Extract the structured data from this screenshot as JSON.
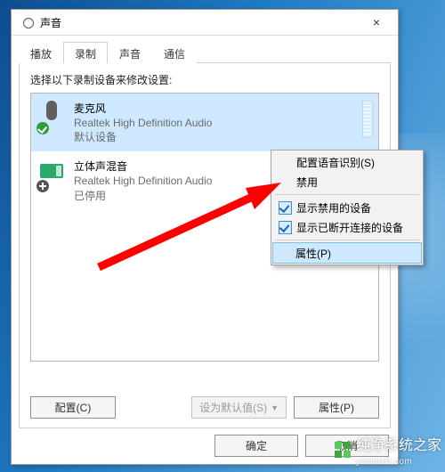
{
  "window": {
    "title": "声音",
    "close_label": "×"
  },
  "tabs": {
    "items": [
      {
        "label": "播放"
      },
      {
        "label": "录制"
      },
      {
        "label": "声音"
      },
      {
        "label": "通信"
      }
    ],
    "active_index": 1
  },
  "prompt": "选择以下录制设备来修改设置:",
  "devices": [
    {
      "name": "麦克风",
      "description": "Realtek High Definition Audio",
      "status": "默认设备",
      "selected": true,
      "badge": "ok",
      "icon": "mic"
    },
    {
      "name": "立体声混音",
      "description": "Realtek High Definition Audio",
      "status": "已停用",
      "selected": false,
      "badge": "off",
      "icon": "card"
    }
  ],
  "bottom_buttons": {
    "configure": "配置(C)",
    "set_default": "设为默认值(S)",
    "properties": "属性(P)"
  },
  "dialog_buttons": {
    "ok": "确定",
    "cancel": "取消"
  },
  "context_menu": {
    "items": [
      {
        "label": "配置语音识别(S)",
        "checked": false
      },
      {
        "label": "禁用",
        "checked": false
      },
      {
        "label": "显示禁用的设备",
        "checked": true
      },
      {
        "label": "显示已断开连接的设备",
        "checked": true
      },
      {
        "label": "属性(P)",
        "checked": false,
        "hover": true
      }
    ]
  },
  "watermark": {
    "brand": "纯净系统之家",
    "url": "ycwin10.com"
  }
}
